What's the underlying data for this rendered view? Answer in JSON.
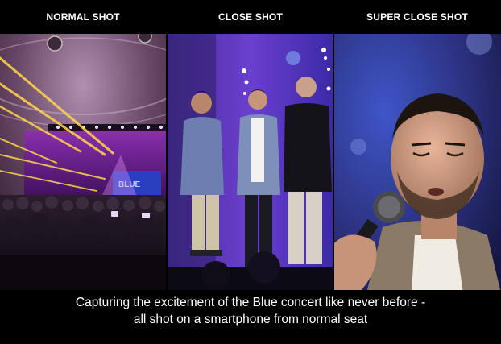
{
  "labels": {
    "normal": "NORMAL SHOT",
    "close": "CLOSE SHOT",
    "super_close": "SUPER CLOSE SHOT"
  },
  "screen_text": "BLUE",
  "caption": {
    "line1": "Capturing the excitement of the Blue concert like never before -",
    "line2": "all shot on a smartphone from normal seat"
  },
  "colors": {
    "background": "#000000",
    "text": "#ffffff",
    "stage_purple": "#b14fd8",
    "beam_yellow": "#ffd84a",
    "stage_blue": "#3a4fd0"
  }
}
